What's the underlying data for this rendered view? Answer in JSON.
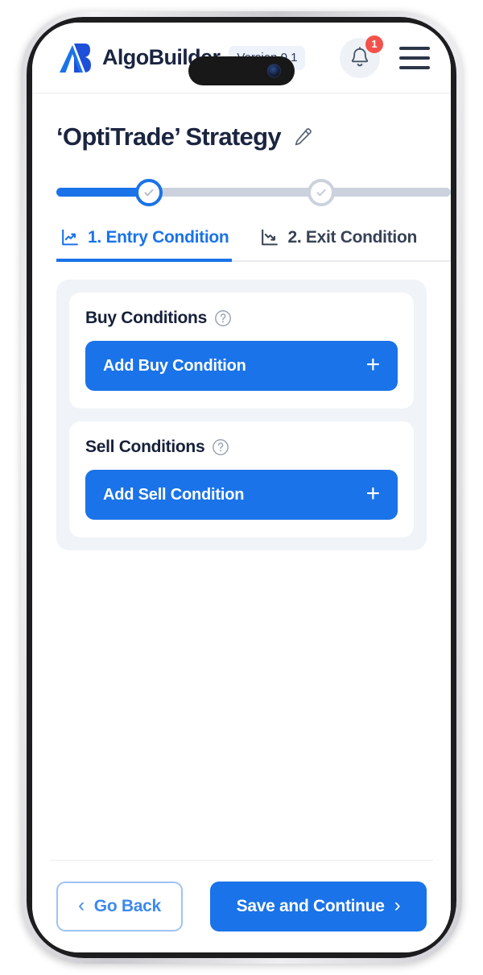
{
  "header": {
    "brand_name": "AlgoBuilder",
    "version_badge": "Version 0.1",
    "logo_icon": "algobuilder-logo",
    "notification_icon": "bell-icon",
    "notification_count": "1",
    "menu_icon": "hamburger-menu-icon"
  },
  "page": {
    "title": "‘OptiTrade’ Strategy",
    "edit_icon": "pencil-edit-icon"
  },
  "progress": {
    "steps": [
      {
        "name": "step-1",
        "state": "done",
        "icon": "check-icon"
      },
      {
        "name": "step-2",
        "state": "todo",
        "icon": "check-icon"
      }
    ]
  },
  "tabs": [
    {
      "label": "1. Entry Condition",
      "icon": "trend-up-chart-icon",
      "active": true
    },
    {
      "label": "2. Exit Condition",
      "icon": "trend-down-chart-icon",
      "active": false
    }
  ],
  "conditions": [
    {
      "title": "Buy Conditions",
      "help_icon": "question-mark-icon",
      "button_label": "Add Buy Condition",
      "button_icon": "plus-icon"
    },
    {
      "title": "Sell Conditions",
      "help_icon": "question-mark-icon",
      "button_label": "Add Sell Condition",
      "button_icon": "plus-icon"
    }
  ],
  "footer": {
    "back_label": "Go Back",
    "back_icon": "chevron-left-icon",
    "continue_label": "Save and Continue",
    "continue_icon": "chevron-right-icon"
  },
  "colors": {
    "accent": "#1a73e8",
    "badge": "#f2524b",
    "text_dark": "#1b2540",
    "panel_bg": "#f0f3f7",
    "track": "#ccd2dd"
  }
}
